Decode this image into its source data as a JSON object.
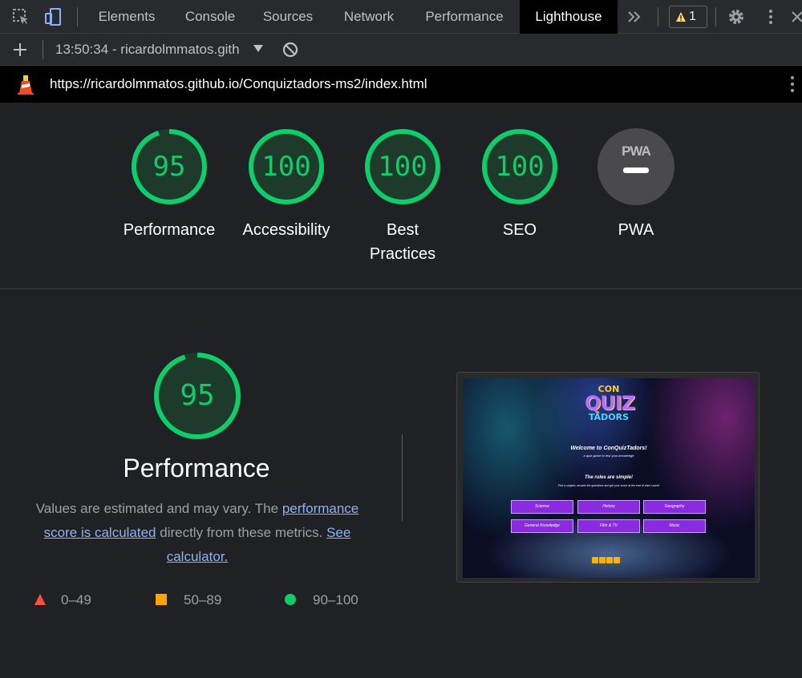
{
  "devtools": {
    "tabs": [
      {
        "label": "Elements"
      },
      {
        "label": "Console"
      },
      {
        "label": "Sources"
      },
      {
        "label": "Network"
      },
      {
        "label": "Performance"
      },
      {
        "label": "Lighthouse"
      }
    ],
    "active_tab": "Lighthouse",
    "more_tabs_icon": "double-chevron-right-icon",
    "warning_count": "1"
  },
  "toolbar": {
    "report_selector": "13:50:34 - ricardolmmatos.gith"
  },
  "urlbar": {
    "url": "https://ricardolmmatos.github.io/Conquiztadors-ms2/index.html"
  },
  "scores": [
    {
      "label": "Performance",
      "value": "95",
      "fraction": 0.95
    },
    {
      "label": "Accessibility",
      "value": "100",
      "fraction": 1.0
    },
    {
      "label": "Best Practices",
      "value": "100",
      "fraction": 1.0
    },
    {
      "label": "SEO",
      "value": "100",
      "fraction": 1.0
    },
    {
      "label": "PWA",
      "value": "",
      "badge_text": "PWA"
    }
  ],
  "performance": {
    "value": "95",
    "fraction": 0.95,
    "title": "Performance",
    "desc_pre": "Values are estimated and may vary. The ",
    "desc_link1": "performance score is calculated",
    "desc_mid": " directly from these metrics. ",
    "desc_link2": "See calculator."
  },
  "legend": [
    {
      "range": "0–49",
      "shape": "triangle",
      "color": "#ff4e42"
    },
    {
      "range": "50–89",
      "shape": "square",
      "color": "#ffa400"
    },
    {
      "range": "90–100",
      "shape": "circle",
      "color": "#0cce6b"
    }
  ],
  "screenshot": {
    "logo_line1": "CON",
    "logo_line2": "QUIZ",
    "logo_line3": "TADORS",
    "welcome": "Welcome to ConQuizTadors!",
    "subtitle": "a quiz game to test your knowledge",
    "rules_title": "The rules are simple!",
    "rules_text": "Pick a subject, answer the questions and get your score at the end of each round!",
    "categories": [
      "Science",
      "History",
      "Geography",
      "General Knowledge",
      "Film & TV",
      "Music"
    ]
  },
  "colors": {
    "pass": "#0cce6b",
    "pass_bg": "#1d3a2a",
    "link": "#8ab4f8",
    "active_tab_bg": "#000000"
  }
}
